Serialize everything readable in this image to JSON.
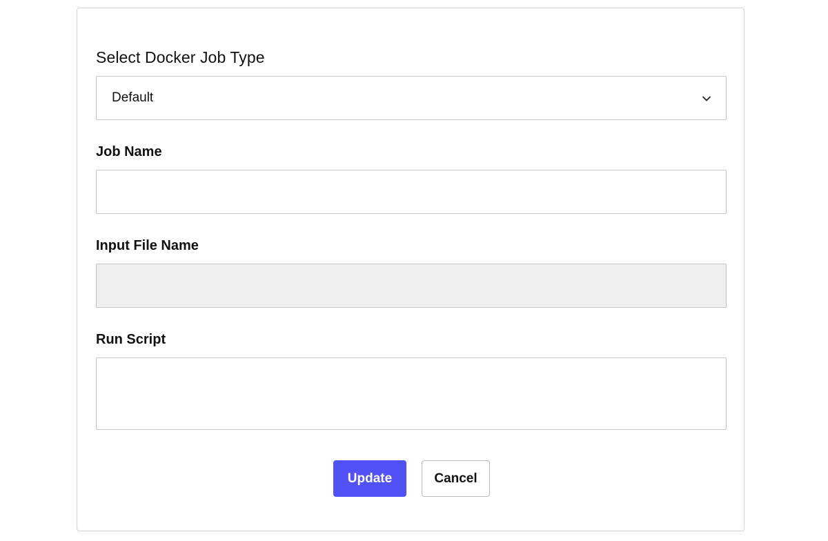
{
  "form": {
    "heading": "Select Docker Job Type",
    "job_type": {
      "selected": "Default",
      "icon": "chevron-down-icon"
    },
    "job_name": {
      "label": "Job Name",
      "value": ""
    },
    "input_file_name": {
      "label": "Input File Name",
      "value": "",
      "disabled": true
    },
    "run_script": {
      "label": "Run Script",
      "value": ""
    },
    "buttons": {
      "update_label": "Update",
      "cancel_label": "Cancel"
    }
  },
  "colors": {
    "primary": "#5151f5",
    "border": "#c4c4c4",
    "disabled_bg": "#efefef",
    "text": "#111111"
  }
}
